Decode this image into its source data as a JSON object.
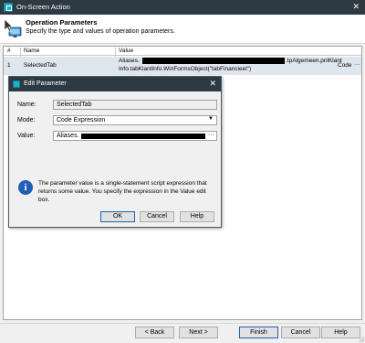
{
  "window": {
    "title": "On-Screen Action",
    "close_glyph": "✕"
  },
  "header": {
    "title": "Operation Parameters",
    "subtitle": "Specify the type and values of operation parameters.",
    "icon": "cursor-monitor-icon"
  },
  "grid": {
    "columns": [
      "#",
      "Name",
      "Value"
    ],
    "rows": [
      {
        "index": "1",
        "name": "SelectedTab",
        "value_line1_prefix": "Aliases.",
        "value_line1_suffix": ".tpAlgemeen.pnlKlant",
        "value_line2": "Info.tabKlantInfo.WinFormsObject(\"tabFinancieel\")",
        "mode": "Code",
        "more": "···"
      }
    ]
  },
  "dialog": {
    "title": "Edit Parameter",
    "close_glyph": "✕",
    "name_label": "Name:",
    "name_value": "SelectedTab",
    "mode_label": "Mode:",
    "mode_value": "Code Expression",
    "value_label": "Value:",
    "value_value": "Aliases.",
    "value_more": "···",
    "info_text": "The parameter value is a single-statement script expression that returns some value. You specify the expression in the Value edit box.",
    "ok": "OK",
    "cancel": "Cancel",
    "help": "Help"
  },
  "footer": {
    "back": "< Back",
    "next": "Next >",
    "finish": "Finish",
    "cancel": "Cancel",
    "help": "Help"
  }
}
